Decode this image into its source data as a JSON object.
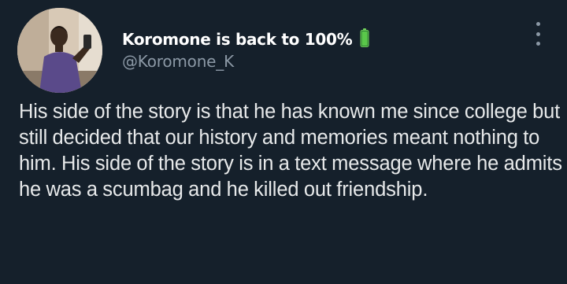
{
  "author": {
    "display_name": "Koromone is back to 100%",
    "handle": "@Koromone_K",
    "status_icon": "battery-full-icon"
  },
  "tweet": {
    "text": "His side of the story is that he has known me since college but still decided that our history and memories meant nothing to him. His side of the story is in a text message where he admits he was a scumbag and he killed out friendship."
  },
  "actions": {
    "more_icon": "more-vertical-icon"
  },
  "colors": {
    "background": "#15202b",
    "primary_text": "#e7e9ea",
    "secondary_text": "#8b98a5",
    "battery_green": "#4caf50"
  }
}
